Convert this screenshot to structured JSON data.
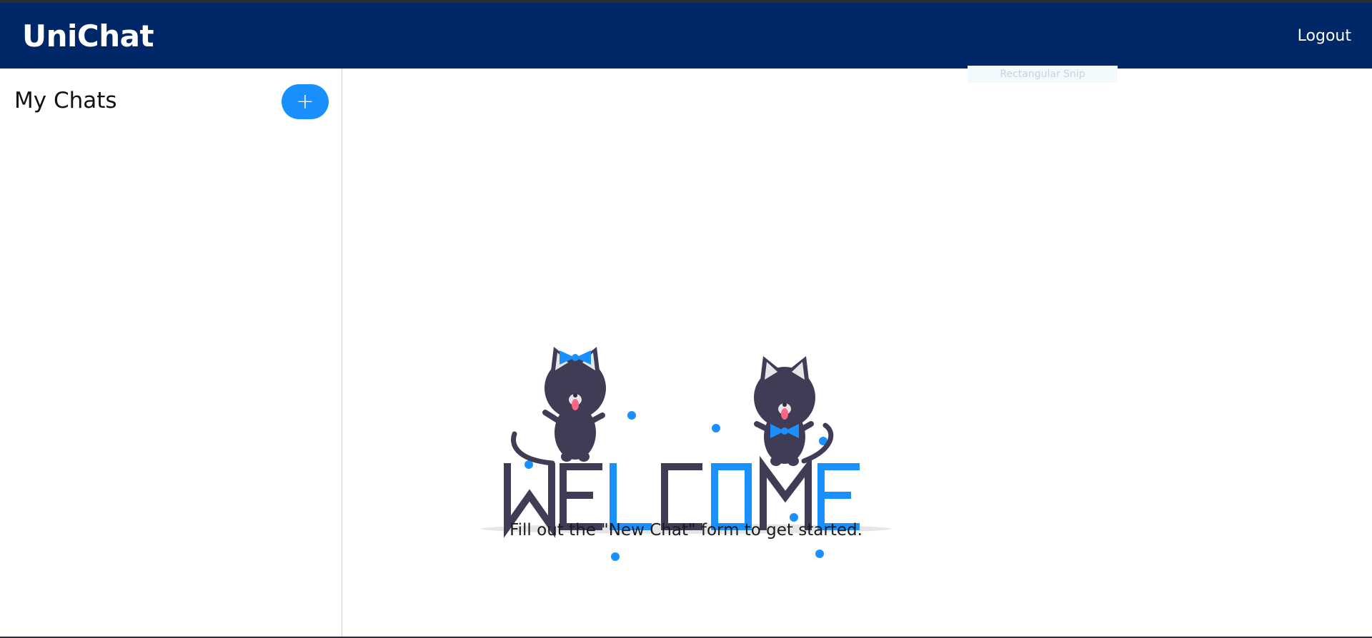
{
  "app": {
    "brand": "UniChat",
    "logout_label": "Logout"
  },
  "overlay": {
    "snip_label": "Rectangular Snip"
  },
  "sidebar": {
    "title": "My Chats",
    "new_chat_icon": "+"
  },
  "main": {
    "welcome_word": "WELCOME",
    "cta": "Fill out the \"New Chat\" form to get started."
  },
  "colors": {
    "navbar": "#002869",
    "accent": "#1a90ff",
    "illustration_dark": "#3f3d56"
  }
}
